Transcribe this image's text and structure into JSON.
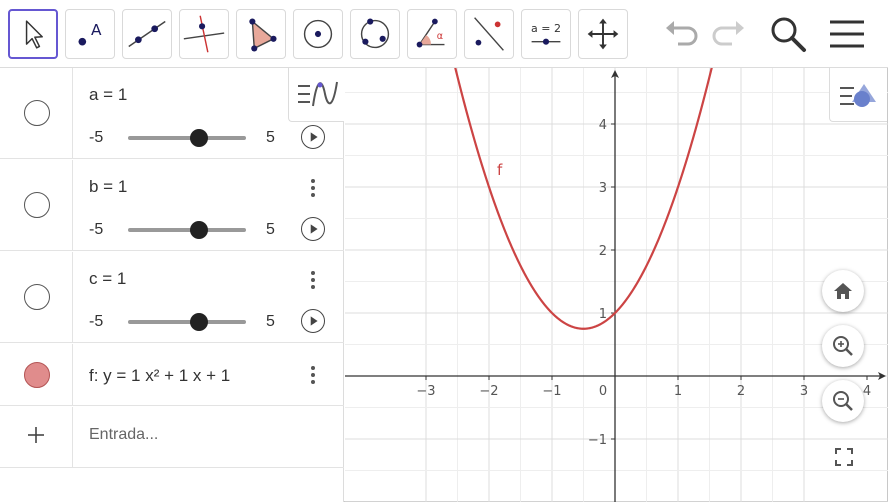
{
  "toolbar": {
    "tools": [
      {
        "name": "move-tool",
        "icon": "cursor-arrow-icon",
        "selected": true
      },
      {
        "name": "point-tool",
        "icon": "point-icon"
      },
      {
        "name": "line-tool",
        "icon": "line-icon"
      },
      {
        "name": "perpendicular-line-tool",
        "icon": "perpendicular-icon"
      },
      {
        "name": "polygon-tool",
        "icon": "polygon-icon"
      },
      {
        "name": "circle-center-point-tool",
        "icon": "circle-icon"
      },
      {
        "name": "circle-three-points-tool",
        "icon": "circle-three-points-icon"
      },
      {
        "name": "angle-tool",
        "icon": "angle-icon"
      },
      {
        "name": "reflect-tool",
        "icon": "reflect-icon"
      },
      {
        "name": "slider-tool",
        "icon": "slider-icon",
        "label": "a = 2"
      },
      {
        "name": "move-graphics-tool",
        "icon": "move-arrows-icon"
      }
    ],
    "undo_icon": "undo-icon",
    "redo_icon": "redo-icon",
    "search_icon": "search-icon",
    "menu_icon": "hamburger-menu-icon",
    "accent": "#6557d2"
  },
  "algebra": {
    "rows": [
      {
        "def": "a = 1",
        "min": "-5",
        "max": "5",
        "value": 1,
        "range": [
          -5,
          5
        ]
      },
      {
        "def": "b = 1",
        "min": "-5",
        "max": "5",
        "value": 1,
        "range": [
          -5,
          5
        ]
      },
      {
        "def": "c = 1",
        "min": "-5",
        "max": "5",
        "value": 1,
        "range": [
          -5,
          5
        ]
      }
    ],
    "function": {
      "def": "f: y = 1 x² + 1 x + 1",
      "color": "#cc4444",
      "marker_color": "#e08c8c"
    },
    "input_placeholder": "Entrada..."
  },
  "graphics": {
    "function_label": "f",
    "x_ticks": [
      "−3",
      "−2",
      "−1",
      "0",
      "1",
      "2",
      "3",
      "4"
    ],
    "y_ticks": [
      "4",
      "3",
      "2",
      "1",
      "−1"
    ],
    "curve_color": "#cc4444",
    "grid": true
  }
}
